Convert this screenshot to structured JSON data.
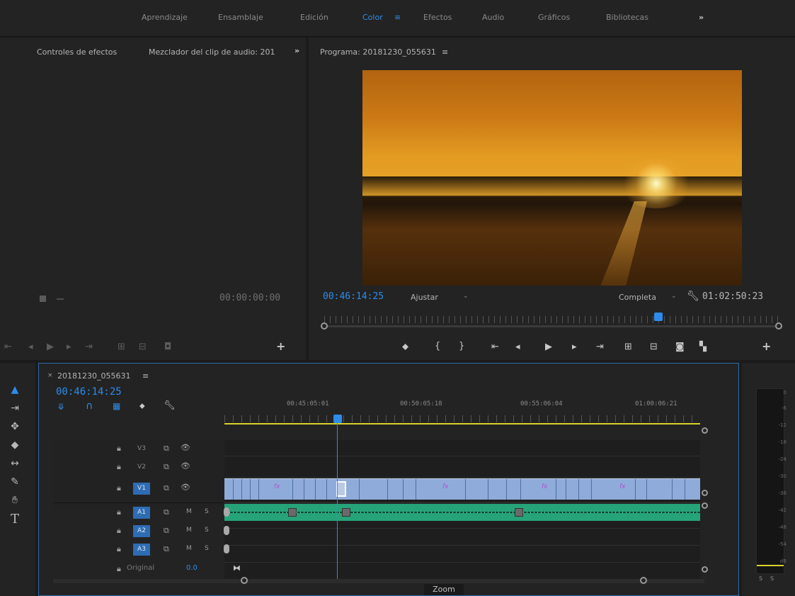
{
  "workspace_tabs": [
    "Aprendizaje",
    "Ensamblaje",
    "Edición",
    "Color",
    "Efectos",
    "Audio",
    "Gráficos",
    "Bibliotecas"
  ],
  "workspace_active": "Color",
  "more_glyph": "»",
  "source_panel": {
    "tab1": "Controles de efectos",
    "tab2": "Mezclador del clip de audio: 201",
    "timecode": "00:00:00:00"
  },
  "program_monitor": {
    "title": "Programa: 20181230_055631",
    "menu_glyph": "≡",
    "current_time": "00:46:14:25",
    "fit": "Ajustar",
    "resolution": "Completa",
    "duration": "01:02:50:23"
  },
  "timeline": {
    "sequence_name": "20181230_055631",
    "current_time": "00:46:14:25",
    "ruler_labels": [
      "00:45:05:01",
      "00:50:05:18",
      "00:55:06:04",
      "01:00:06:21"
    ],
    "video_tracks": [
      "V3",
      "V2",
      "V1"
    ],
    "audio_tracks": [
      "A1",
      "A2",
      "A3"
    ],
    "mute_label": "M",
    "solo_label": "S",
    "master_label": "Original",
    "master_value": "0.0",
    "fx_label": "fx",
    "zoom_label": "Zoom"
  },
  "audio_meter": {
    "ticks": [
      "0",
      "-6",
      "-12",
      "-18",
      "-24",
      "-30",
      "-36",
      "-42",
      "-48",
      "-54",
      "dB"
    ],
    "solo_buttons": [
      "S",
      "S"
    ]
  },
  "colors": {
    "accent": "#2d8ceb",
    "video_clip": "#8fabd9",
    "audio_clip": "#27a379",
    "work_area": "#d8d22a"
  }
}
